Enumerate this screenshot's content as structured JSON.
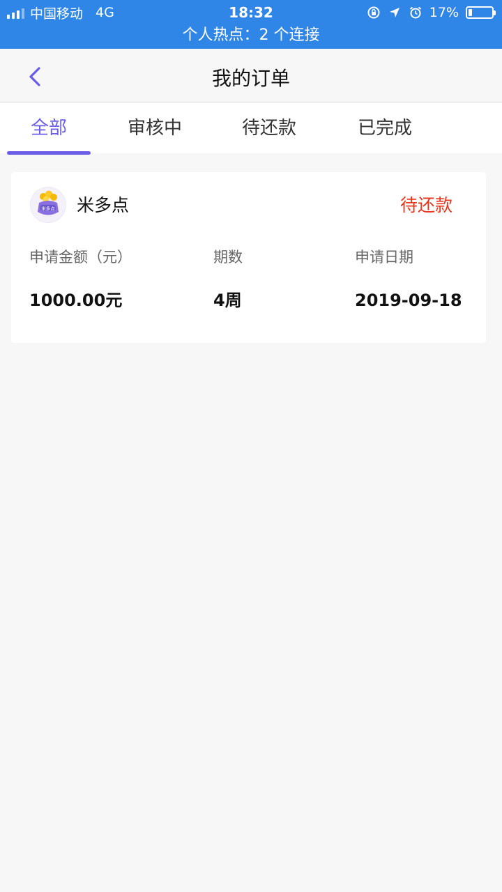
{
  "status_bar": {
    "carrier": "中国移动",
    "network": "4G",
    "time": "18:32",
    "battery": "17%",
    "battery_level": 0.17,
    "hotspot": "个人热点：2 个连接"
  },
  "header": {
    "title": "我的订单"
  },
  "tabs": [
    {
      "label": "全部",
      "active": true
    },
    {
      "label": "审核中",
      "active": false
    },
    {
      "label": "待还款",
      "active": false
    },
    {
      "label": "已完成",
      "active": false
    }
  ],
  "order": {
    "lender": "米多点",
    "logo_text": "米多点",
    "status": "待还款",
    "columns": [
      {
        "label": "申请金额（元）",
        "value": "1000.00元"
      },
      {
        "label": "期数",
        "value": "4周"
      },
      {
        "label": "申请日期",
        "value": "2019-09-18"
      }
    ]
  },
  "colors": {
    "status_bar_bg": "#2f86e6",
    "accent": "#6b5ce7",
    "status_red": "#e8361f",
    "page_bg": "#f7f7f7"
  }
}
